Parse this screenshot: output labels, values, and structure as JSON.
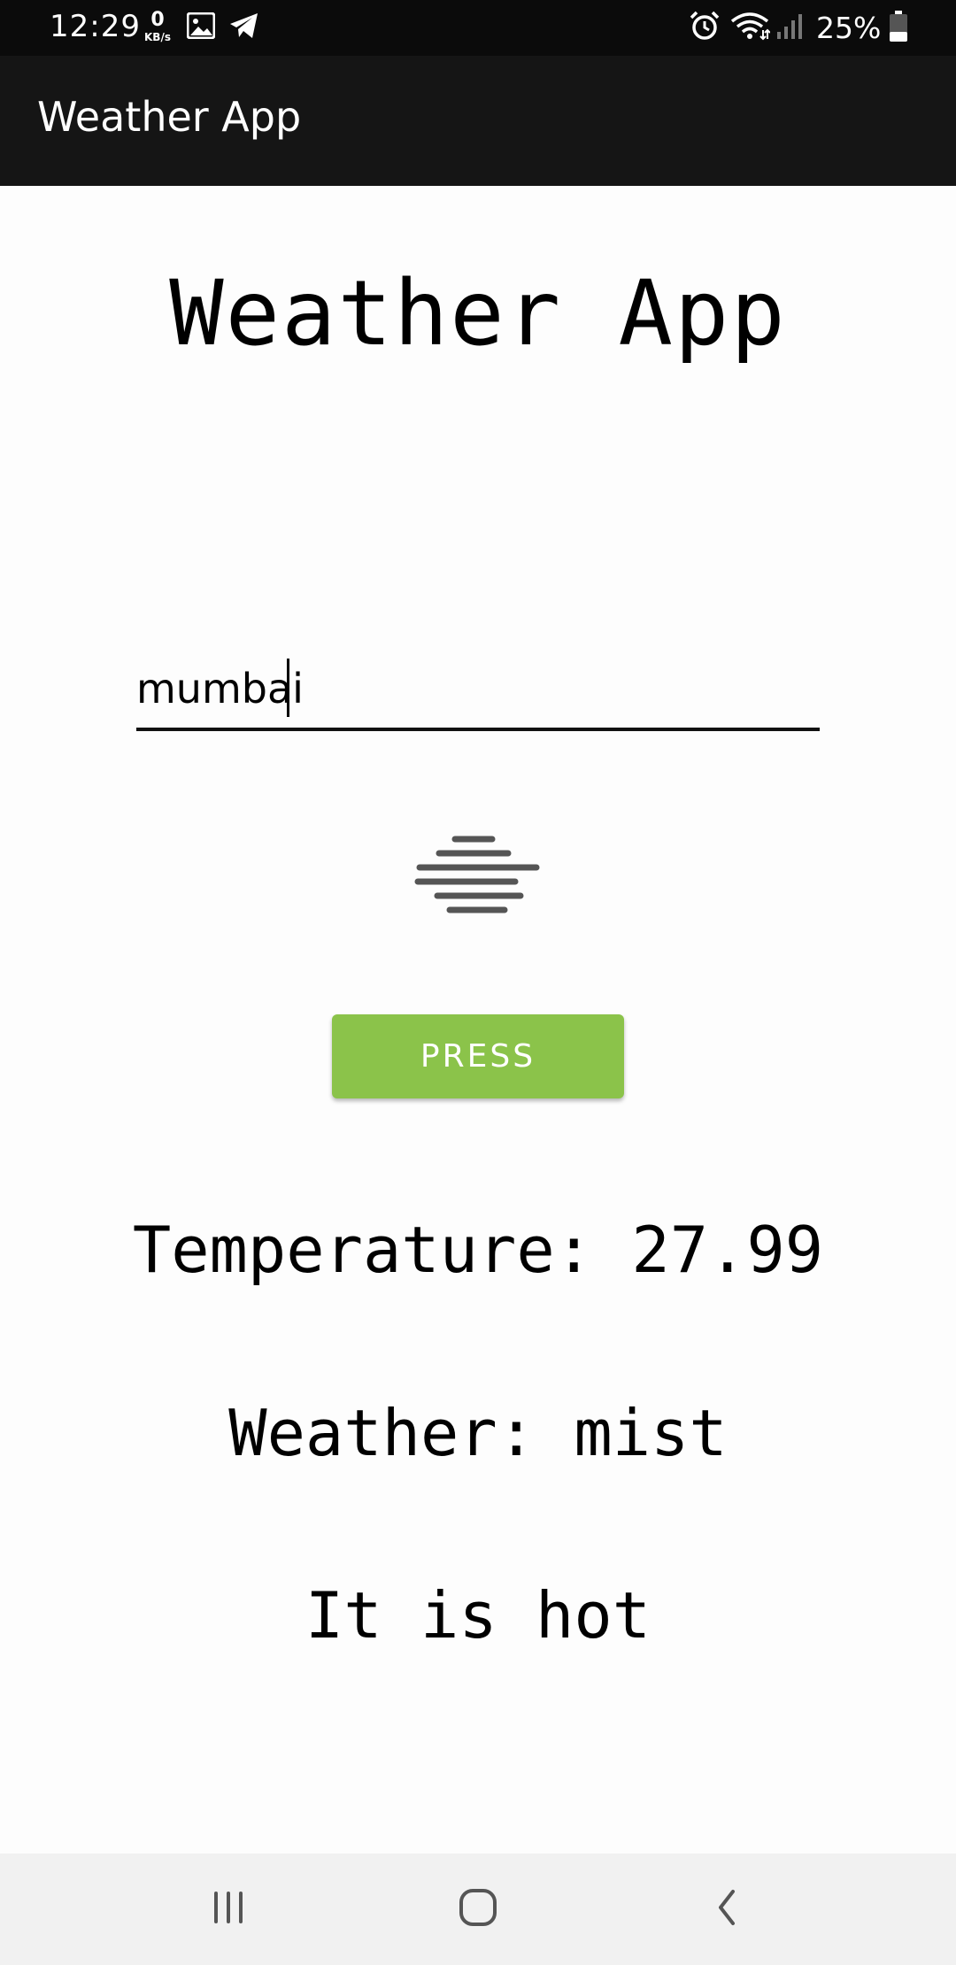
{
  "status_bar": {
    "time": "12:29",
    "net_speed_value": "0",
    "net_speed_unit": "KB/s",
    "battery_percent": "25%",
    "icons": [
      "image-icon",
      "telegram-icon",
      "alarm-icon",
      "wifi-icon",
      "signal-icon",
      "battery-icon"
    ]
  },
  "app_bar": {
    "title": "Weather App"
  },
  "main": {
    "heading": "Weather App",
    "city_input": {
      "value": "mumbai"
    },
    "weather_icon": "mist-icon",
    "press_button_label": "PRESS",
    "temperature_text": "Temperature: 27.99",
    "weather_text": "Weather: mist",
    "feel_text": "It is hot"
  },
  "nav_bar": {
    "icons": [
      "recents-icon",
      "home-icon",
      "back-icon"
    ]
  },
  "colors": {
    "status_bar_bg": "#0b0b0b",
    "app_bar_bg": "#151515",
    "button_bg": "#8bc34a",
    "page_bg": "#fdfdfd",
    "nav_bar_bg": "#f1f1f1"
  }
}
